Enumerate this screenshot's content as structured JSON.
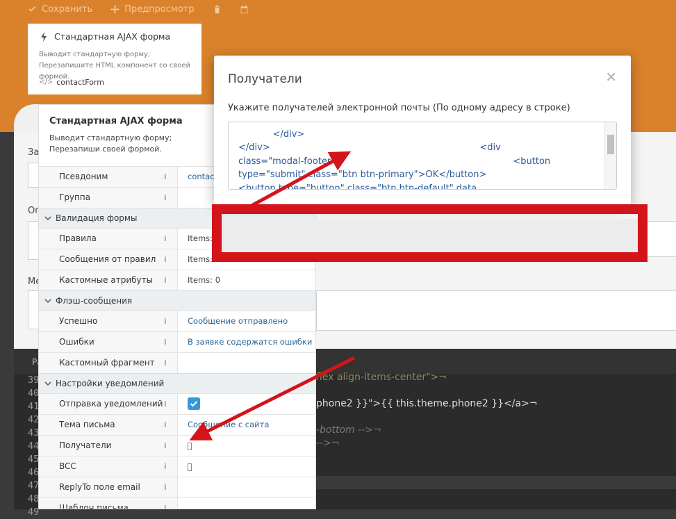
{
  "toolbar": {
    "save_label": "Сохранить",
    "preview_label": "Предпросмотр"
  },
  "component": {
    "title": "Стандартная AJAX форма",
    "description": "Выводит стандартную форму; Перезапишите HTML компонент со своей формой.",
    "alias": "contactForm"
  },
  "inspector": {
    "title": "Стандартная AJAX форма",
    "description": "Выводит стандартную форму; Перезапиши своей формой.",
    "rows": [
      {
        "type": "prop",
        "name": "Псевдоним",
        "value": "contact"
      },
      {
        "type": "prop",
        "name": "Группа",
        "value": ""
      },
      {
        "type": "group",
        "name": "Валидация формы"
      },
      {
        "type": "prop",
        "name": "Правила",
        "value": "Items:",
        "dark": true
      },
      {
        "type": "prop",
        "name": "Сообщения от правил",
        "value": "Items:",
        "dark": true
      },
      {
        "type": "prop",
        "name": "Кастомные атрибуты",
        "value": "Items: 0",
        "dark": true
      },
      {
        "type": "group",
        "name": "Флэш-сообщения"
      },
      {
        "type": "prop",
        "name": "Успешно",
        "value": "Сообщение отправлено"
      },
      {
        "type": "prop",
        "name": "Ошибки",
        "value": "В заявке содержатся ошибки"
      },
      {
        "type": "prop",
        "name": "Кастомный фрагмент",
        "value": ""
      },
      {
        "type": "group",
        "name": "Настройки уведомлений"
      },
      {
        "type": "prop",
        "name": "Отправка уведомлений",
        "value": "",
        "checkbox": true
      },
      {
        "type": "prop",
        "name": "Тема письма",
        "value": "Сообщение с сайта"
      },
      {
        "type": "prop",
        "name": "Получатели",
        "value": "",
        "square": true
      },
      {
        "type": "prop",
        "name": "BCC",
        "value": "",
        "square": true
      },
      {
        "type": "prop",
        "name": "ReplyTo поле email",
        "value": ""
      },
      {
        "type": "prop",
        "name": "Шаблон письма",
        "value": ""
      }
    ]
  },
  "modal": {
    "title": "Получатели",
    "close": "×",
    "label": "Укажите получателей электронной почты (По одному адресу в строке)",
    "textarea_lines": [
      "            </div>",
      "</div>                                                                         <div",
      "class=\"modal-footer\"                                                              <button",
      "type=\"submit\" class=\"btn btn-primary\">OK</button>",
      "<button type=\"button\" class=\"btn btn-default\" data"
    ]
  },
  "background_labels": [
    "За",
    "Оп",
    "Ме"
  ],
  "editor": {
    "header": "Ра",
    "line_numbers": [
      "39",
      "40",
      "41",
      "42",
      "43",
      "44",
      "45",
      "46",
      "47",
      "48",
      "49"
    ],
    "code_lines": [
      {
        "line": 0,
        "text": "flex align-items-center\">¬"
      },
      {
        "line": 2,
        "text": "phone2 }}\">{{ this.theme.phone2 }}</a>¬"
      },
      {
        "line": 4,
        "text": "-bottom -->¬"
      },
      {
        "line": 5,
        "text": "-->¬"
      }
    ]
  }
}
